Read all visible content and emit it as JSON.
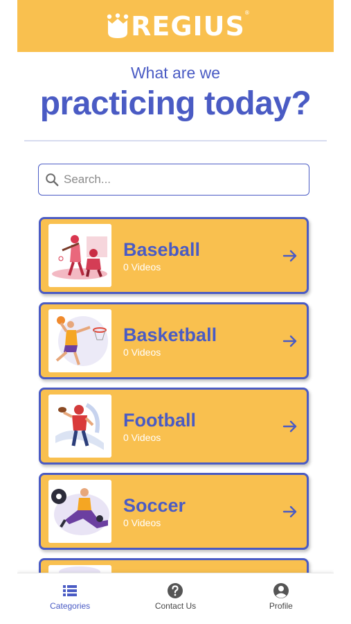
{
  "header": {
    "logo_text": "REGIUS",
    "trademark": "®"
  },
  "page": {
    "title_line1": "What are we",
    "title_line2": "practicing today?"
  },
  "search": {
    "placeholder": "Search..."
  },
  "categories": [
    {
      "name": "Baseball",
      "count": "0 Videos",
      "icon": "baseball-illustration"
    },
    {
      "name": "Basketball",
      "count": "0 Videos",
      "icon": "basketball-illustration"
    },
    {
      "name": "Football",
      "count": "0 Videos",
      "icon": "football-illustration"
    },
    {
      "name": "Soccer",
      "count": "0 Videos",
      "icon": "soccer-illustration"
    },
    {
      "name": "",
      "count": "",
      "icon": "partial-illustration"
    }
  ],
  "bottom_nav": [
    {
      "label": "Categories",
      "icon": "list-icon",
      "active": true
    },
    {
      "label": "Contact Us",
      "icon": "question-icon",
      "active": false
    },
    {
      "label": "Profile",
      "icon": "user-circle-icon",
      "active": false
    }
  ],
  "colors": {
    "accent": "#4a5bc4",
    "brand_yellow": "#f9c04f",
    "white": "#ffffff"
  }
}
